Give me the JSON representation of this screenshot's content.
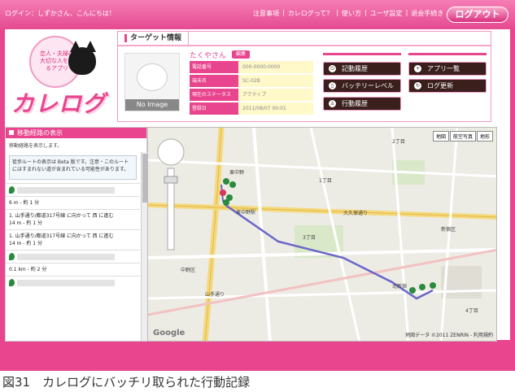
{
  "header": {
    "greeting": "ログイン：しずかさん、こんにちは！",
    "nav": [
      "注意事項",
      "カレログって？",
      "使い方",
      "ユーザ設定",
      "退会手続き"
    ],
    "logout_label": "ログアウト"
  },
  "logo": {
    "badge_text": "恋人・夫婦の大切な人を守るアプリ",
    "title": "カレログ"
  },
  "target": {
    "tab_label": "ターゲット情報",
    "name": "たくやさん",
    "name_badge": "編集",
    "no_image": "No Image",
    "info": [
      {
        "key": "電話番号",
        "value": "000-0000-0000"
      },
      {
        "key": "端末名",
        "value": "SC-02B"
      },
      {
        "key": "現在のステータス",
        "value": "アクティブ"
      },
      {
        "key": "登録日",
        "value": "2011/08/07 00:01"
      }
    ],
    "buttons": {
      "history": "記動履歴",
      "battery": "バッテリーレベル",
      "movement": "行動履歴",
      "apps": "アプリ一覧",
      "log_update": "ログ更新"
    }
  },
  "route": {
    "title": "移動経路の表示",
    "subtitle": "移動経路を表示します。",
    "note": "徒歩ルートの表示は Beta 版です。注意・このルートにはすまれない道が含まれている可能性があります。",
    "steps": [
      {
        "prefix": "",
        "dist": ""
      },
      {
        "prefix": "6 m - 約 1 分",
        "dist": ""
      },
      {
        "prefix": "1. 山手通り/都道317号線 に向かって 西 に進む",
        "dist": "14 m - 約 1 分"
      },
      {
        "prefix": "1. 山手通り/都道317号線 に向かって 西 に進む",
        "dist": "14 m - 約 1 分"
      },
      {
        "prefix": "",
        "dist": ""
      },
      {
        "prefix": "0.1 km - 約 2 分",
        "dist": ""
      }
    ]
  },
  "map": {
    "types": [
      "地図",
      "航空写真",
      "地形"
    ],
    "credit": "地図データ ©2011 ZENRIN - 利用規約",
    "google": "Google",
    "labels": [
      "東中野",
      "東中野駅",
      "北新宿",
      "1丁目",
      "2丁目",
      "3丁目",
      "4丁目",
      "大久保通り",
      "山手通り",
      "中野区",
      "新宿区"
    ]
  },
  "caption": "図31　カレログにバッチリ取られた行動記録"
}
